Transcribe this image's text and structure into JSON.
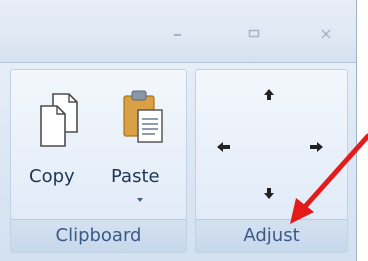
{
  "window": {
    "controls": [
      "minimize",
      "maximize",
      "close"
    ]
  },
  "ribbon": {
    "clipboard": {
      "label": "Clipboard",
      "copy_label": "Copy",
      "paste_label": "Paste"
    },
    "adjust": {
      "label": "Adjust",
      "arrows": [
        "up",
        "left",
        "right",
        "down"
      ]
    }
  },
  "colors": {
    "ribbon_bg": "#dce7f4",
    "group_label_text": "#3b5a85",
    "highlight_arrow": "#e31b1b"
  }
}
